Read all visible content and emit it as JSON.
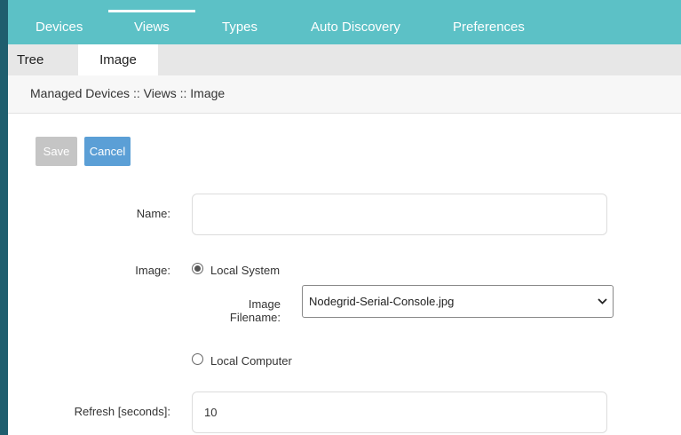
{
  "top_nav": {
    "tabs": [
      {
        "label": "Devices"
      },
      {
        "label": "Views",
        "active": true
      },
      {
        "label": "Types"
      },
      {
        "label": "Auto Discovery"
      },
      {
        "label": "Preferences"
      }
    ]
  },
  "sub_nav": {
    "tabs": [
      {
        "label": "Tree"
      },
      {
        "label": "Image",
        "active": true
      }
    ]
  },
  "breadcrumb": "Managed Devices :: Views :: Image",
  "actions": {
    "save_label": "Save",
    "cancel_label": "Cancel"
  },
  "form": {
    "name": {
      "label": "Name:",
      "value": ""
    },
    "image": {
      "label": "Image:",
      "options": [
        {
          "label": "Local System",
          "selected": true
        },
        {
          "label": "Local Computer",
          "selected": false
        }
      ],
      "filename_label_line1": "Image",
      "filename_label_line2": "Filename:",
      "filename_value": "Nodegrid-Serial-Console.jpg"
    },
    "refresh": {
      "label": "Refresh [seconds]:",
      "value": "10"
    }
  },
  "colors": {
    "nav_bg": "#5cc1c6",
    "save_disabled": "#c5c5c5",
    "cancel_bg": "#5b9fd6"
  }
}
